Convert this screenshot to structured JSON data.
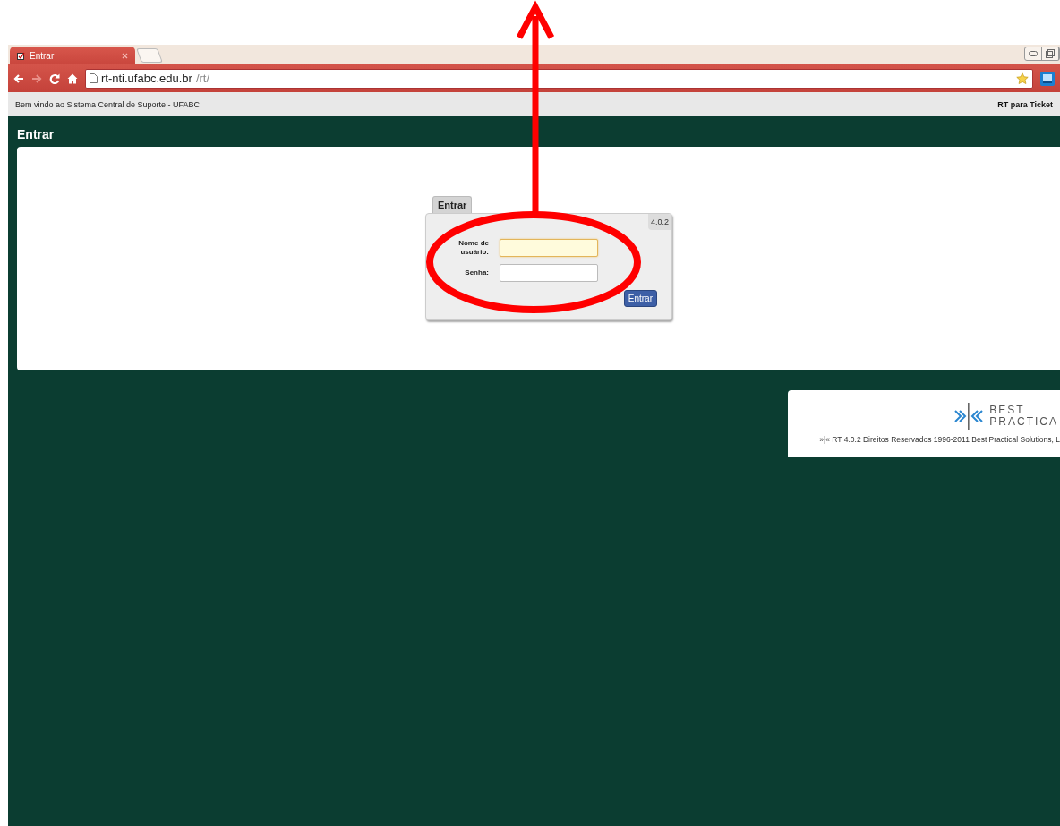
{
  "browser": {
    "tab": {
      "title": "Entrar",
      "selected": true
    },
    "address_bar": {
      "host": "rt-nti.ufabc.edu.br",
      "path": "/rt/"
    }
  },
  "header": {
    "welcome": "Bem vindo ao Sistema Central de Suporte - UFABC",
    "link": "RT para Ticket"
  },
  "page_title": "Entrar",
  "login": {
    "tab": "Entrar",
    "version": "4.0.2",
    "fields": [
      {
        "label": "Nome de usuário:",
        "focused": true
      },
      {
        "label": "Senha:",
        "focused": false
      }
    ],
    "submit": "Entrar"
  },
  "footer": {
    "logo_line1": "BEST",
    "logo_line2": "PRACTICA",
    "copyright": "»|« RT 4.0.2 Direitos Reservados 1996-2011 Best Practical Solutions, L"
  }
}
